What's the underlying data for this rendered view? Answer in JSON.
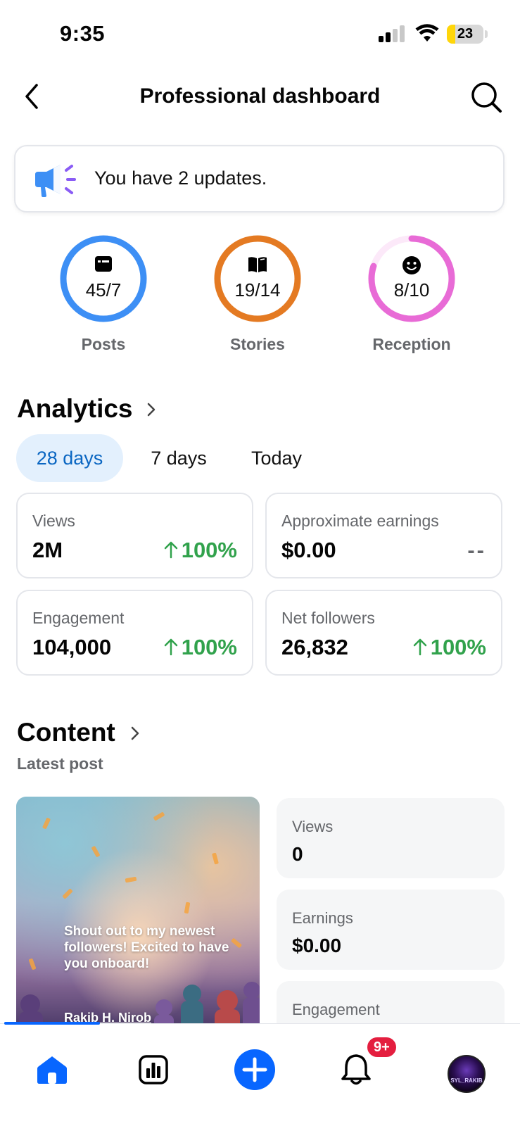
{
  "status_bar": {
    "time": "9:35",
    "battery_percent": "23",
    "battery_level": 0.23,
    "signal_bars_active": 2,
    "signal_bars_total": 4
  },
  "header": {
    "title": "Professional dashboard",
    "back_icon": "chevron-left-icon",
    "search_icon": "search-icon"
  },
  "updates": {
    "text": "You have 2 updates.",
    "icon": "megaphone-icon"
  },
  "rings": [
    {
      "label": "Posts",
      "value": "45/7",
      "color": "#3d8ff5",
      "progress": 1.0,
      "icon": "post-icon"
    },
    {
      "label": "Stories",
      "value": "19/14",
      "color": "#e47a22",
      "progress": 1.0,
      "icon": "book-icon"
    },
    {
      "label": "Reception",
      "value": "8/10",
      "color": "#e86bd6",
      "progress": 0.8,
      "icon": "smiley-icon"
    }
  ],
  "analytics": {
    "title": "Analytics",
    "tabs": [
      "28 days",
      "7 days",
      "Today"
    ],
    "active_tab": "28 days",
    "metrics": [
      {
        "label": "Views",
        "value": "2M",
        "change": "100%"
      },
      {
        "label": "Approximate earnings",
        "value": "$0.00",
        "change": "--"
      },
      {
        "label": "Engagement",
        "value": "104,000",
        "change": "100%"
      },
      {
        "label": "Net followers",
        "value": "26,832",
        "change": "100%"
      }
    ]
  },
  "content": {
    "title": "Content",
    "subtitle": "Latest post",
    "post": {
      "text": "Shout out to my newest followers! Excited to have you onboard!",
      "author": "Rakib H. Nirob"
    },
    "stats": [
      {
        "label": "Views",
        "value": "0"
      },
      {
        "label": "Earnings",
        "value": "$0.00"
      },
      {
        "label": "Engagement",
        "value": ""
      }
    ]
  },
  "bottom_nav": {
    "items": [
      "home-icon",
      "insights-icon",
      "create-icon",
      "notifications-icon",
      "profile-avatar"
    ],
    "notification_badge": "9+",
    "avatar_text": "SYL_RAKIB",
    "accent": "#0866ff"
  }
}
